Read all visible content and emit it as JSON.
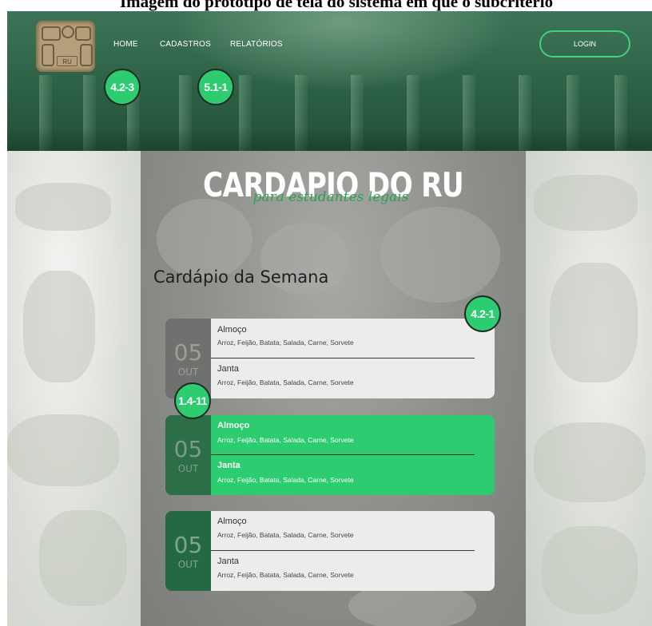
{
  "doc_title": "Imagem do protótipo de tela do sistema em que o subcriterio",
  "header": {
    "logo_text": "RU",
    "nav": [
      {
        "label": "HOME"
      },
      {
        "label": "CADASTROS"
      },
      {
        "label": "RELATÓRIOS"
      }
    ],
    "login_label": "LOGIN"
  },
  "badges": {
    "home": "4.2-3",
    "relatorios": "5.1-1",
    "card1": "4.2-1",
    "card2": "1.4-11"
  },
  "brand": {
    "title": "CARDAPIO DO RU",
    "tagline": "para estudantes legais"
  },
  "section_title": "Cardápio da Semana",
  "menu_cards": [
    {
      "day": "05",
      "month": "OUT",
      "lunch_label": "Almoço",
      "lunch_items": "Arroz, Feijão, Batata, Salada, Carne, Sorvete",
      "dinner_label": "Janta",
      "dinner_items": "Arroz, Feijão, Batata, Salada, Carne, Sorvete"
    },
    {
      "day": "05",
      "month": "OUT",
      "lunch_label": "Almoço",
      "lunch_items": "Arroz, Feijão, Batata, Salada, Carne, Sorvete",
      "dinner_label": "Janta",
      "dinner_items": "Arroz, Feijão, Batata, Salada, Carne, Sorvete"
    },
    {
      "day": "05",
      "month": "OUT",
      "lunch_label": "Almoço",
      "lunch_items": "Arroz, Feijão, Batata, Salada, Carne, Sorvete",
      "dinner_label": "Janta",
      "dinner_items": "Arroz, Feijão, Batata, Salada, Carne, Sorvete"
    }
  ],
  "colors": {
    "accent_green": "#2ecc71",
    "header_green": "#2b5f44",
    "login_border": "#3fd17f"
  }
}
